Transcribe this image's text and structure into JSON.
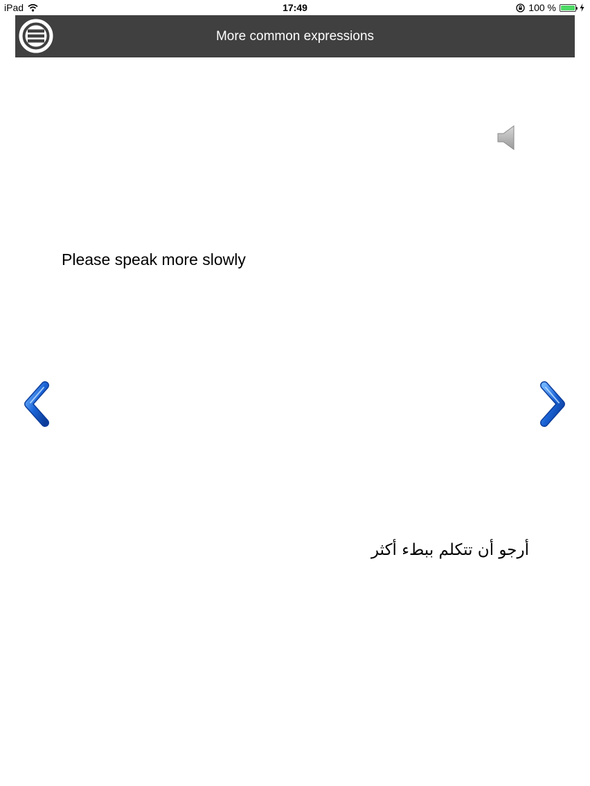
{
  "status_bar": {
    "device": "iPad",
    "time": "17:49",
    "battery_percent": "100 %",
    "battery_level": 1.0,
    "icons": [
      "wifi-icon",
      "orientation-lock-icon",
      "battery-icon",
      "charging-icon"
    ]
  },
  "navbar": {
    "title": "More common expressions",
    "menu_icon": "menu-icon",
    "background": "#404040"
  },
  "phrase": {
    "english": "Please speak more slowly",
    "arabic": "أرجو أن تتكلم ببطء أكثر"
  },
  "controls": {
    "speaker_icon": "speaker-icon",
    "prev_icon": "chevron-left-icon",
    "next_icon": "chevron-right-icon",
    "accent": "#1a63d6"
  }
}
